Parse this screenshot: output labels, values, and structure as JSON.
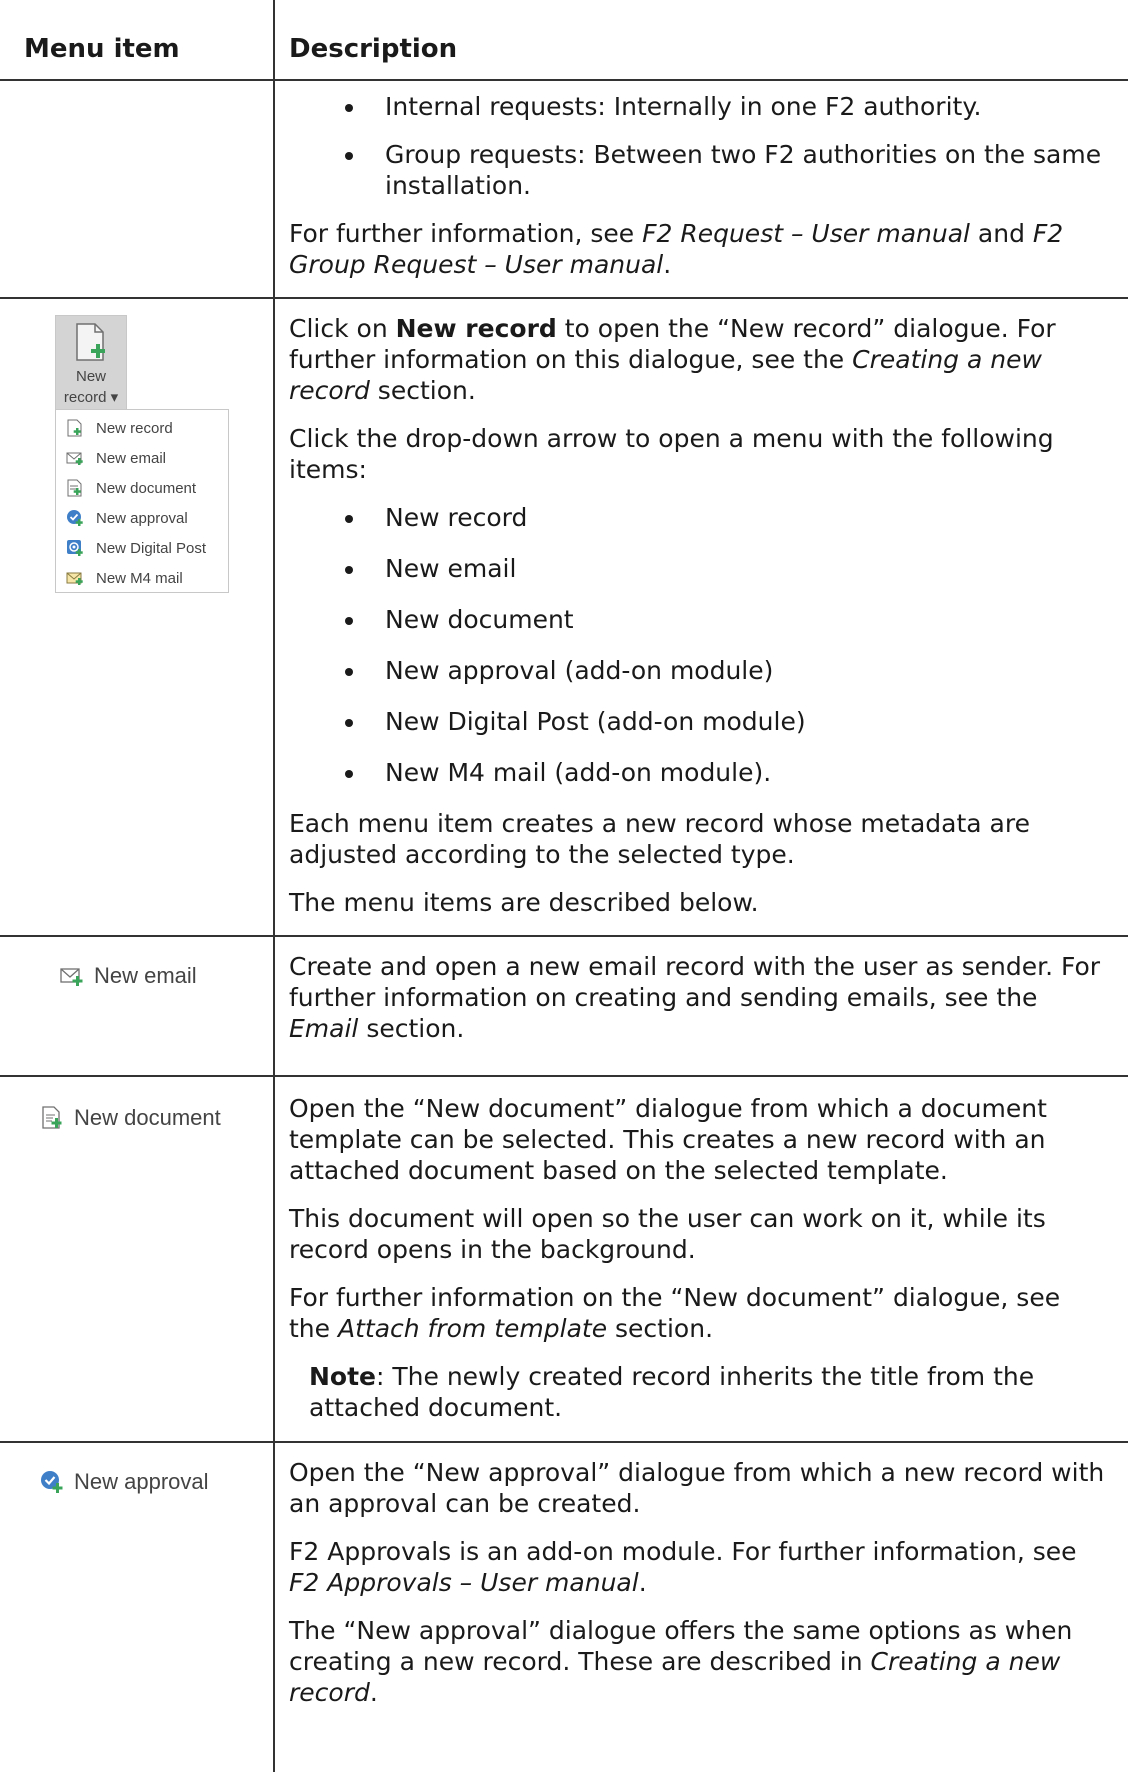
{
  "header": {
    "col1": "Menu item",
    "col2": "Description"
  },
  "row1": {
    "bullets": [
      "Internal requests: Internally in one F2 authority.",
      "Group requests: Between two F2 authorities on the same installation."
    ],
    "para_pre": "For further information, see ",
    "ref1": "F2 Request – User manual",
    "para_mid": " and ",
    "ref2": "F2 Group Request – User manual",
    "para_post": "."
  },
  "row2": {
    "ribbon": {
      "line1": "New",
      "line2": "record ▾"
    },
    "menu_items": [
      {
        "label": "New record",
        "icon": "new-record-icon"
      },
      {
        "label": "New email",
        "icon": "new-email-icon"
      },
      {
        "label": "New document",
        "icon": "new-document-icon"
      },
      {
        "label": "New approval",
        "icon": "new-approval-icon"
      },
      {
        "label": "New Digital Post",
        "icon": "new-digital-post-icon"
      },
      {
        "label": "New M4 mail",
        "icon": "new-m4-mail-icon"
      }
    ],
    "p1_pre": "Click on ",
    "p1_bold": "New record",
    "p1_mid": " to open the “New record” dialogue. For further information on this dialogue, see the ",
    "p1_ref": "Creating a new record",
    "p1_post": " section.",
    "p2": "Click the drop-down arrow to open a menu with the following items:",
    "bullets": [
      "New record",
      "New email",
      "New document",
      "New approval (add-on module)",
      "New Digital Post (add-on module)",
      "New M4 mail (add-on module)."
    ],
    "p3": "Each menu item creates a new record whose metadata are adjusted according to the selected type.",
    "p4": "The menu items are described below."
  },
  "row3": {
    "item_label": "New email",
    "p1_pre": "Create and open a new email record with the user as sender. For further information on creating and sending emails, see the ",
    "p1_ref": "Email",
    "p1_post": " section."
  },
  "row4": {
    "item_label": "New document",
    "p1": "Open the “New document” dialogue from which a document template can be selected. This creates a new record with an attached document based on the selected template.",
    "p2": "This document will open so the user can work on it, while its record opens in the background.",
    "p3_pre": "For further information on the “New document” dialogue, see the ",
    "p3_ref": "Attach from template",
    "p3_post": " section.",
    "note_bold": "Note",
    "note_text": ": The newly created record inherits the title from the attached document."
  },
  "row5": {
    "item_label": "New approval",
    "p1": "Open the “New approval” dialogue from which a new record with an approval can be created.",
    "p2_pre": "F2 Approvals is an add-on module. For further information, see ",
    "p2_ref": "F2 Approvals – User manual",
    "p2_post": ".",
    "p3_pre": "The “New approval” dialogue offers the same options as when creating a new record. These are described in ",
    "p3_ref": "Creating a new record",
    "p3_post": "."
  },
  "colors": {
    "rule": "#333333",
    "icon_green": "#3aa55a",
    "icon_blue": "#3f7fc8",
    "ribbon_bg": "#d4d4d4"
  }
}
